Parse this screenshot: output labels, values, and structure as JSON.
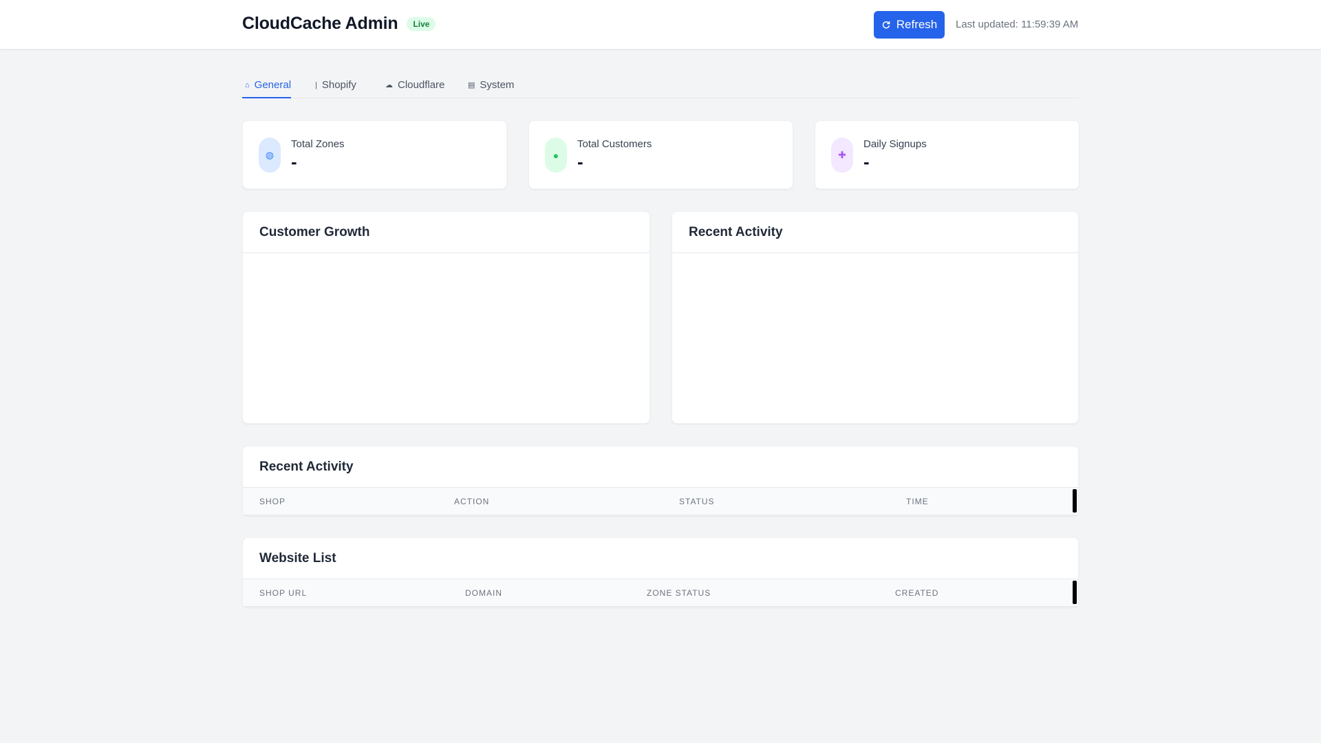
{
  "header": {
    "title": "CloudCache Admin",
    "badge": "Live",
    "refresh_label": "Refresh",
    "last_updated": "Last updated: 11:59:39 AM"
  },
  "tabs": [
    {
      "label": "General",
      "icon": "home-icon",
      "active": true
    },
    {
      "label": "Shopify",
      "icon": "shopify-icon",
      "active": false
    },
    {
      "label": "Cloudflare",
      "icon": "cloud-icon",
      "active": false
    },
    {
      "label": "System",
      "icon": "server-icon",
      "active": false
    }
  ],
  "stats": [
    {
      "label": "Total Zones",
      "value": "-",
      "icon": "globe-icon",
      "color": "#3b82f6",
      "bg": "#dbeafe"
    },
    {
      "label": "Total Customers",
      "value": "-",
      "icon": "users-icon",
      "color": "#22c55e",
      "bg": "#dcfce7"
    },
    {
      "label": "Daily Signups",
      "value": "-",
      "icon": "user-plus-icon",
      "color": "#a855f7",
      "bg": "#f3e8ff"
    }
  ],
  "panels": {
    "growth_title": "Customer Growth",
    "activity_title": "Recent Activity"
  },
  "activity_table": {
    "title": "Recent Activity",
    "columns": [
      "Shop",
      "Action",
      "Status",
      "Time"
    ]
  },
  "website_table": {
    "title": "Website List",
    "columns": [
      "Shop URL",
      "Domain",
      "Zone Status",
      "Created"
    ]
  },
  "colors": {
    "accent": "#2563eb",
    "background": "#f3f4f6"
  }
}
